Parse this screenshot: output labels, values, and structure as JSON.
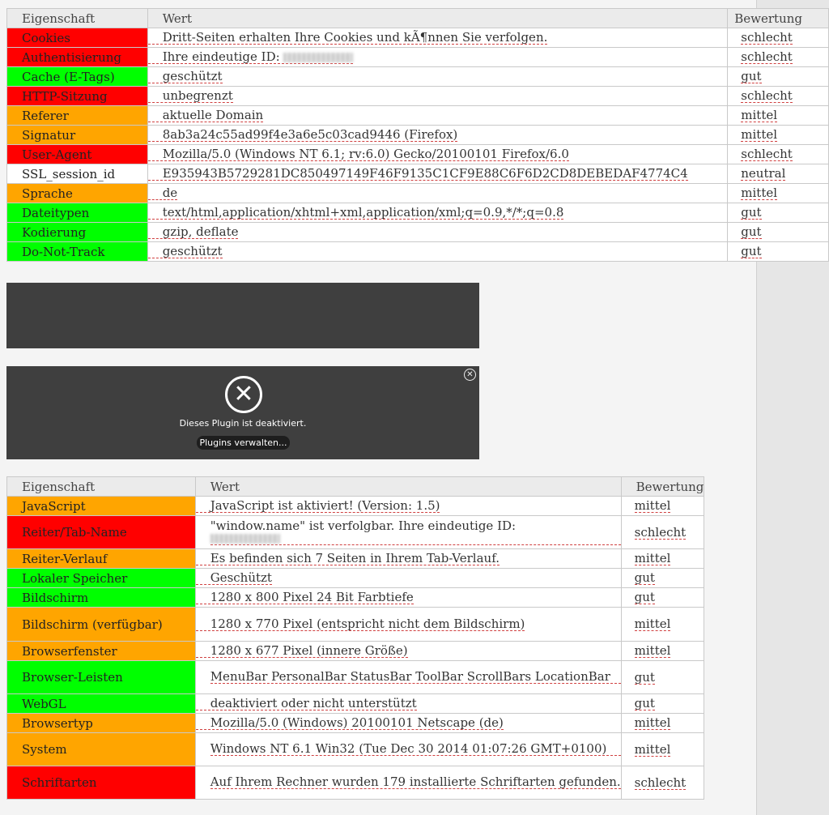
{
  "table1": {
    "headers": [
      "Eigenschaft",
      "Wert",
      "Bewertung"
    ],
    "rows": [
      {
        "name": "Cookies",
        "value": "Dritt-Seiten erhalten Ihre Cookies und kÃ¶nnen Sie verfolgen.",
        "rating": "schlecht",
        "color": "#ff0000"
      },
      {
        "name": "Authentisierung",
        "value": "Ihre eindeutige ID:",
        "rating": "schlecht",
        "color": "#ff0000"
      },
      {
        "name": "Cache (E-Tags)",
        "value": "geschützt",
        "rating": "gut",
        "color": "#00ff00"
      },
      {
        "name": "HTTP-Sitzung",
        "value": "unbegrenzt",
        "rating": "schlecht",
        "color": "#ff0000"
      },
      {
        "name": "Referer",
        "value": "aktuelle Domain",
        "rating": "mittel",
        "color": "#ffa500"
      },
      {
        "name": "Signatur",
        "value": "8ab3a24c55ad99f4e3a6e5c03cad9446 (Firefox)",
        "rating": "mittel",
        "color": "#ffa500"
      },
      {
        "name": "User-Agent",
        "value": "Mozilla/5.0 (Windows NT 6.1; rv:6.0) Gecko/20100101 Firefox/6.0",
        "rating": "schlecht",
        "color": "#ff0000"
      },
      {
        "name": "SSL_session_id",
        "value": "E935943B5729281DC850497149F46F9135C1CF9E88C6F6D2CD8DEBEDAF4774C4",
        "rating": "neutral",
        "color": "#ffffff"
      },
      {
        "name": "Sprache",
        "value": "de",
        "rating": "mittel",
        "color": "#ffa500"
      },
      {
        "name": "Dateitypen",
        "value": "text/html,application/xhtml+xml,application/xml;q=0.9,*/*;q=0.8",
        "rating": "gut",
        "color": "#00ff00"
      },
      {
        "name": "Kodierung",
        "value": "gzip, deflate",
        "rating": "gut",
        "color": "#00ff00"
      },
      {
        "name": "Do-Not-Track",
        "value": "geschützt",
        "rating": "gut",
        "color": "#00ff00"
      }
    ]
  },
  "plugin": {
    "message": "Dieses Plugin ist deaktiviert.",
    "button_label": "Plugins verwalten...",
    "close_icon": "circle-x-icon",
    "main_icon": "circle-x-icon"
  },
  "table2": {
    "headers": [
      "Eigenschaft",
      "Wert",
      "Bewertung"
    ],
    "rows": [
      {
        "name": "JavaScript",
        "value": "JavaScript ist aktiviert! (Version: 1.5)",
        "rating": "mittel",
        "color": "#ffa500"
      },
      {
        "name": "Reiter/Tab-Name",
        "value": "\"window.name\" ist verfolgbar. Ihre eindeutige ID:",
        "rating": "schlecht",
        "color": "#ff0000"
      },
      {
        "name": "Reiter-Verlauf",
        "value": "Es befinden sich 7 Seiten in Ihrem Tab-Verlauf.",
        "rating": "mittel",
        "color": "#ffa500"
      },
      {
        "name": "Lokaler Speicher",
        "value": "Geschützt",
        "rating": "gut",
        "color": "#00ff00"
      },
      {
        "name": "Bildschirm",
        "value": "1280 x 800 Pixel 24 Bit Farbtiefe",
        "rating": "gut",
        "color": "#00ff00"
      },
      {
        "name": "Bildschirm (verfügbar)",
        "value": "1280 x 770 Pixel (entspricht nicht dem Bildschirm)",
        "rating": "mittel",
        "color": "#ffa500"
      },
      {
        "name": "Browserfenster",
        "value": "1280 x 677 Pixel (innere Größe)",
        "rating": "mittel",
        "color": "#ffa500"
      },
      {
        "name": "Browser-Leisten",
        "value": "MenuBar PersonalBar StatusBar ToolBar ScrollBars LocationBar",
        "rating": "gut",
        "color": "#00ff00"
      },
      {
        "name": "WebGL",
        "value": "deaktiviert oder nicht unterstützt",
        "rating": "gut",
        "color": "#00ff00"
      },
      {
        "name": "Browsertyp",
        "value": "Mozilla/5.0 (Windows) 20100101 Netscape (de)",
        "rating": "mittel",
        "color": "#ffa500"
      },
      {
        "name": "System",
        "value": "Windows NT 6.1 Win32 (Tue Dec 30 2014 01:07:26 GMT+0100)",
        "rating": "mittel",
        "color": "#ffa500"
      },
      {
        "name": "Schriftarten",
        "value": "Auf Ihrem Rechner wurden 179 installierte Schriftarten gefunden.",
        "rating": "schlecht",
        "color": "#ff0000"
      }
    ]
  }
}
